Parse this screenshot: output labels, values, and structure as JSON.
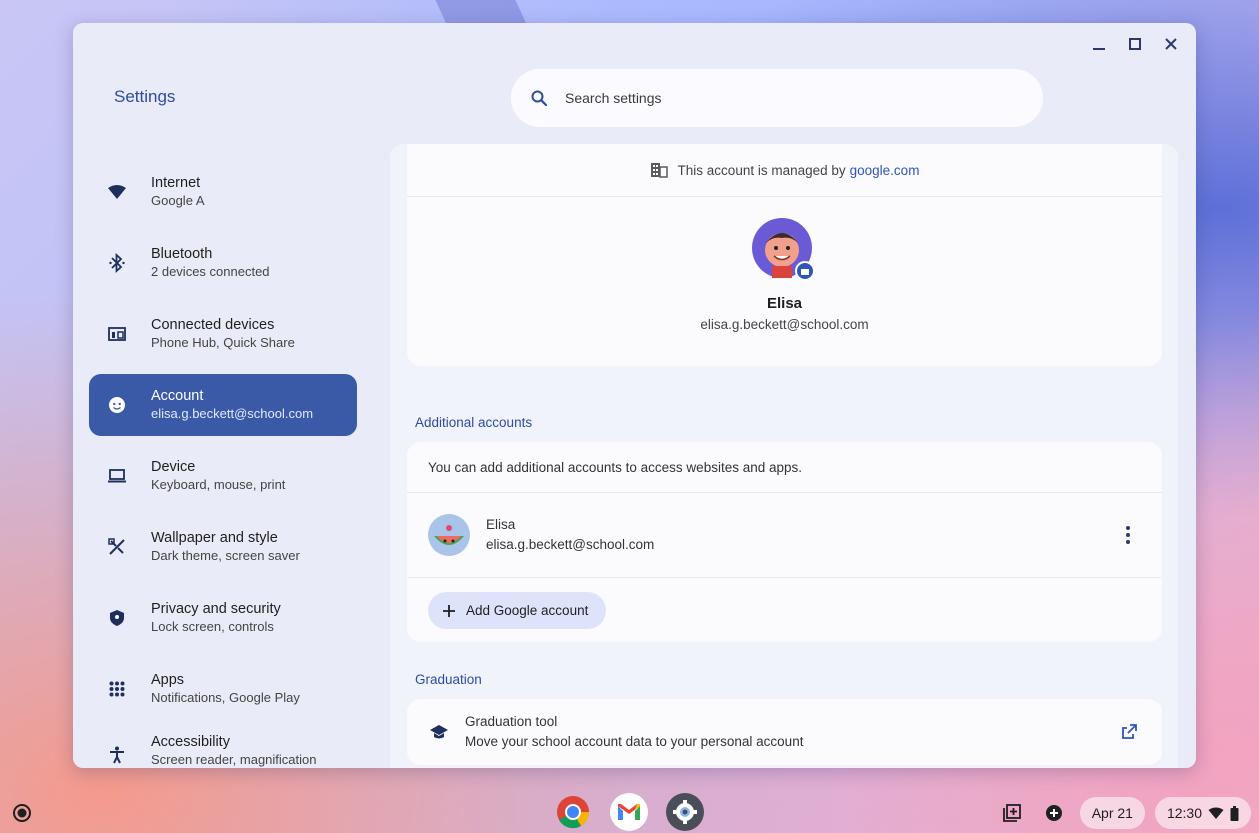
{
  "window": {
    "minimize": "minimize",
    "maximize": "maximize",
    "close": "close"
  },
  "app_title": "Settings",
  "search": {
    "placeholder": "Search settings"
  },
  "sidebar": {
    "items": [
      {
        "label": "Internet",
        "sub": "Google A",
        "icon": "wifi-icon"
      },
      {
        "label": "Bluetooth",
        "sub": "2 devices connected",
        "icon": "bluetooth-icon"
      },
      {
        "label": "Connected devices",
        "sub": "Phone Hub, Quick Share",
        "icon": "devices-icon"
      },
      {
        "label": "Account",
        "sub": "elisa.g.beckett@school.com",
        "icon": "account-icon",
        "active": true
      },
      {
        "label": "Device",
        "sub": "Keyboard, mouse, print",
        "icon": "laptop-icon"
      },
      {
        "label": "Wallpaper and style",
        "sub": "Dark theme, screen saver",
        "icon": "palette-icon"
      },
      {
        "label": "Privacy and security",
        "sub": "Lock screen, controls",
        "icon": "shield-icon"
      },
      {
        "label": "Apps",
        "sub": "Notifications, Google Play",
        "icon": "apps-grid-icon"
      },
      {
        "label": "Accessibility",
        "sub": "Screen reader, magnification",
        "icon": "accessibility-icon"
      }
    ]
  },
  "profile": {
    "managed_prefix": "This account is managed by",
    "managed_domain": "google.com",
    "name": "Elisa",
    "email": "elisa.g.beckett@school.com"
  },
  "additional": {
    "title": "Additional accounts",
    "description": "You can add additional accounts to access websites and apps.",
    "account_name": "Elisa",
    "account_email": "elisa.g.beckett@school.com",
    "add_label": "Add Google account"
  },
  "graduation": {
    "title": "Graduation",
    "tool_title": "Graduation tool",
    "tool_sub": "Move your school account data to your personal account"
  },
  "shelf": {
    "date": "Apr 21",
    "time": "12:30"
  },
  "colors": {
    "accent": "#3a5aa8",
    "link": "#2f55b8",
    "section": "#2f4aa0"
  }
}
